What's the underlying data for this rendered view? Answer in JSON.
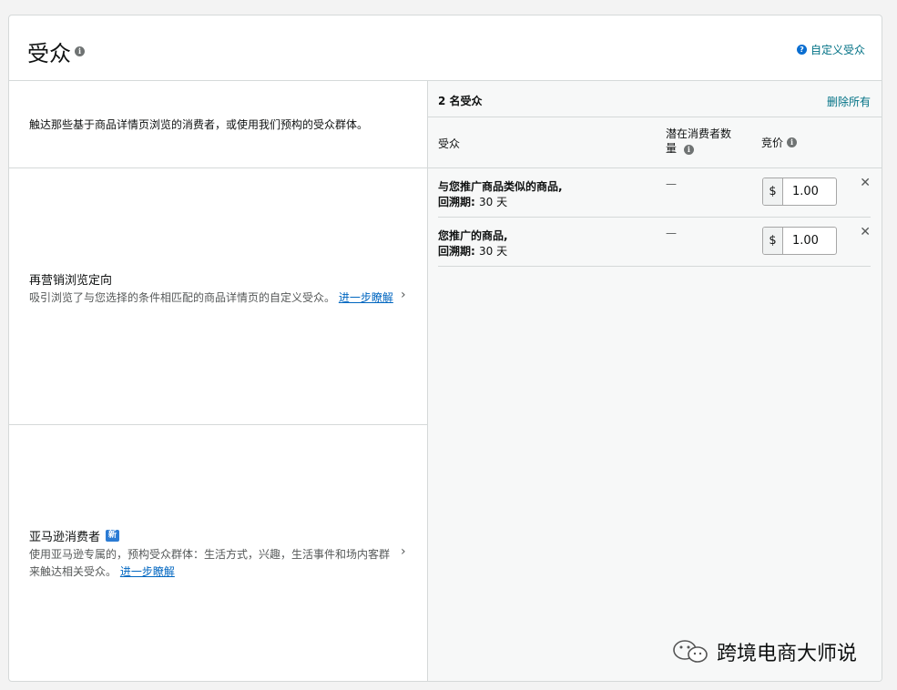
{
  "header": {
    "title": "受众",
    "info": "i",
    "help_icon": "?",
    "custom_link": "自定义受众"
  },
  "left": {
    "intro": "触达那些基于商品详情页浏览的消费者，或使用我们预构的受众群体。",
    "options": [
      {
        "title": "再营销浏览定向",
        "desc": "吸引浏览了与您选择的条件相匹配的商品详情页的自定义受众。",
        "link": "进一步瞭解"
      },
      {
        "title": "亚马逊消费者",
        "badge": "新",
        "desc": "使用亚马逊专属的，预构受众群体：生活方式，兴趣，生活事件和场内客群来触达相关受众。",
        "link": "进一步瞭解"
      }
    ]
  },
  "right": {
    "count": "2 名受众",
    "remove_all": "删除所有",
    "columns": {
      "audience": "受众",
      "potential": "潜在消费者数量",
      "bid": "竞价"
    },
    "rows": [
      {
        "name": "与您推广商品类似的商品,",
        "lookback_label": "回溯期:",
        "lookback_value": "30 天",
        "potential": "—",
        "currency": "$",
        "bid": "1.00"
      },
      {
        "name": "您推广的商品,",
        "lookback_label": "回溯期:",
        "lookback_value": "30 天",
        "potential": "—",
        "currency": "$",
        "bid": "1.00"
      }
    ]
  },
  "watermark": "跨境电商大师说",
  "icons": {
    "info": "info-icon",
    "help": "help-icon",
    "chevron": "chevron-right-icon",
    "close": "close-icon"
  }
}
